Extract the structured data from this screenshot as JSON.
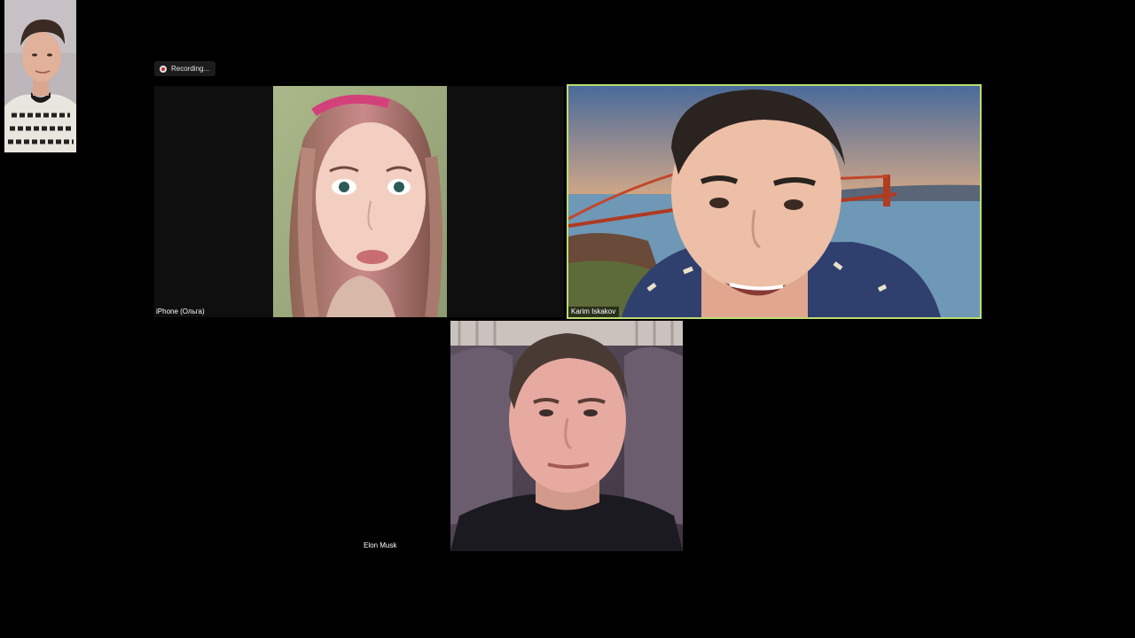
{
  "recording": {
    "label": "Recording...",
    "icon": "record-icon",
    "indicator_color": "#d3262d"
  },
  "self_view": {
    "icon": "self-video-thumbnail"
  },
  "participants": [
    {
      "name": "iPhone (Ольга)",
      "active_speaker": false
    },
    {
      "name": "Karim Iskakov",
      "active_speaker": true,
      "highlight_color": "#b9dd73"
    },
    {
      "name": "Elon Musk",
      "active_speaker": false
    }
  ],
  "colors": {
    "background": "#000000",
    "active_speaker_border": "#b9dd73"
  }
}
